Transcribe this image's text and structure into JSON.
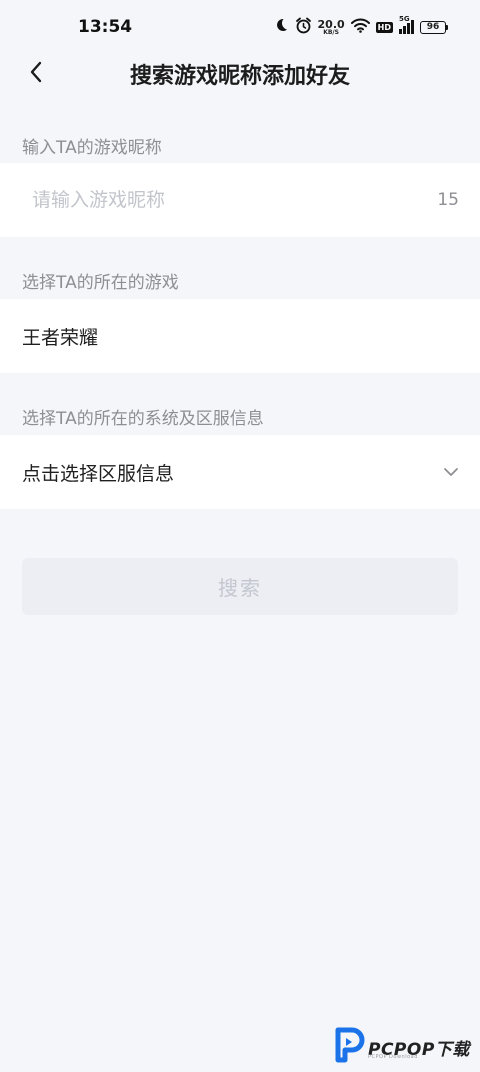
{
  "status_bar": {
    "time": "13:54",
    "net_speed_value": "20.0",
    "net_speed_unit": "KB/S",
    "hd_label": "HD",
    "network_label": "5G",
    "battery": "96"
  },
  "header": {
    "title": "搜索游戏昵称添加好友"
  },
  "nickname_section": {
    "label": "输入TA的游戏昵称",
    "placeholder": "请输入游戏昵称",
    "value": "",
    "counter": "15"
  },
  "game_section": {
    "label": "选择TA的所在的游戏",
    "value": "王者荣耀"
  },
  "server_section": {
    "label": "选择TA的所在的系统及区服信息",
    "value": "点击选择区服信息"
  },
  "search_button": {
    "label": "搜索"
  },
  "watermark": {
    "text": "PCPOP下载",
    "subtext": "PCPOP Download"
  },
  "colors": {
    "background": "#f5f6fa",
    "card": "#ffffff",
    "label_gray": "#8e8e93",
    "placeholder_gray": "#c3c5cc",
    "button_disabled_bg": "#eceef4",
    "button_disabled_text": "#c4c7cf",
    "watermark_blue": "#1a73e8"
  }
}
